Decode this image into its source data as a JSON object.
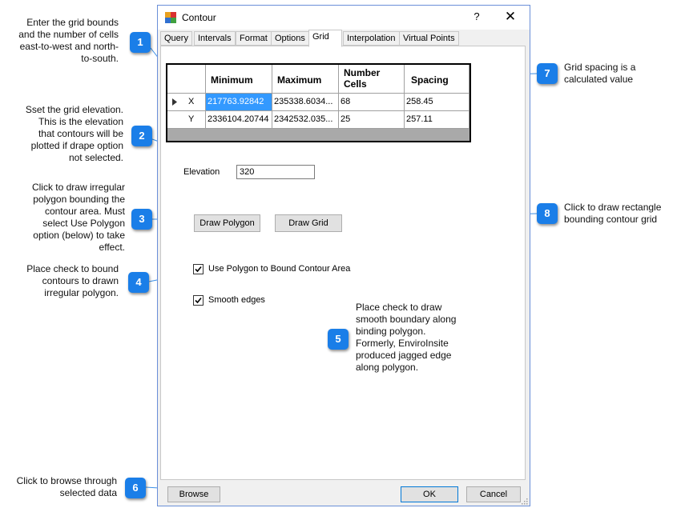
{
  "window": {
    "title": "Contour",
    "help_label": "?",
    "close_label": "✕"
  },
  "tabs": [
    "Query",
    "Intervals",
    "Format",
    "Options",
    "Grid",
    "Interpolation",
    "Virtual Points"
  ],
  "active_tab": "Grid",
  "grid_table": {
    "columns": [
      "Minimum",
      "Maximum",
      "Number Cells",
      "Spacing"
    ],
    "rows": [
      {
        "axis": "X",
        "min": "217763.92842",
        "max": "235338.6034...",
        "cells": "68",
        "spacing": "258.45"
      },
      {
        "axis": "Y",
        "min": "2336104.20744",
        "max": "2342532.035...",
        "cells": "25",
        "spacing": "257.11"
      }
    ]
  },
  "elevation": {
    "label": "Elevation",
    "value": "320"
  },
  "buttons": {
    "draw_polygon": "Draw Polygon",
    "draw_grid": "Draw Grid",
    "browse": "Browse",
    "ok": "OK",
    "cancel": "Cancel"
  },
  "checkboxes": {
    "use_polygon": {
      "label": "Use Polygon to Bound Contour Area",
      "checked": true
    },
    "smooth_edges": {
      "label": "Smooth edges",
      "checked": true
    }
  },
  "annotations": [
    {
      "num": "1",
      "text": [
        "Enter the grid bounds",
        "and the number of cells",
        "east-to-west and north-",
        "to-south."
      ]
    },
    {
      "num": "2",
      "text": [
        "Sset the grid elevation.",
        "This is the elevation",
        "that contours will be",
        "plotted if drape option",
        "not selected."
      ]
    },
    {
      "num": "3",
      "text": [
        "Click to draw irregular",
        "polygon bounding the",
        "contour area.  Must",
        "select Use Polygon",
        "option (below) to take",
        "effect."
      ]
    },
    {
      "num": "4",
      "text": [
        "Place check to bound",
        "contours to drawn",
        "irregular polygon."
      ]
    },
    {
      "num": "5",
      "text": [
        "Place check to draw",
        "smooth boundary along",
        "binding polygon.",
        "Formerly, EnviroInsite",
        "produced jagged edge",
        "along polygon."
      ]
    },
    {
      "num": "6",
      "text": [
        "Click to browse through",
        "selected data"
      ]
    },
    {
      "num": "7",
      "text": [
        "Grid spacing is a",
        "calculated value"
      ]
    },
    {
      "num": "8",
      "text": [
        "Click to draw rectangle",
        "bounding contour grid"
      ]
    }
  ],
  "colors": {
    "badge": "#1a7ee8",
    "selected_cell": "#3399ff",
    "window_border": "#6a8fd8"
  }
}
